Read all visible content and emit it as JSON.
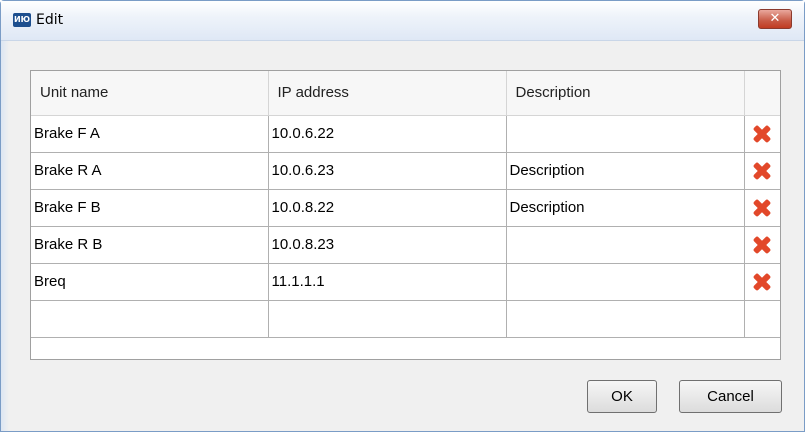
{
  "window": {
    "title": "Edit",
    "app_icon_text": "ИЮ",
    "close_label": "✕"
  },
  "table": {
    "columns": [
      "Unit name",
      "IP address",
      "Description",
      ""
    ],
    "rows": [
      {
        "unit_name": "Brake F A",
        "ip": "10.0.6.22",
        "description": ""
      },
      {
        "unit_name": "Brake R A",
        "ip": "10.0.6.23",
        "description": "Description"
      },
      {
        "unit_name": "Brake F B",
        "ip": "10.0.8.22",
        "description": "Description"
      },
      {
        "unit_name": "Brake R B",
        "ip": "10.0.8.23",
        "description": ""
      },
      {
        "unit_name": "Breq",
        "ip": "11.1.1.1",
        "description": ""
      }
    ]
  },
  "buttons": {
    "ok": "OK",
    "cancel": "Cancel"
  },
  "colors": {
    "delete_icon": "#e2482a",
    "close_button": "#c85a45"
  }
}
